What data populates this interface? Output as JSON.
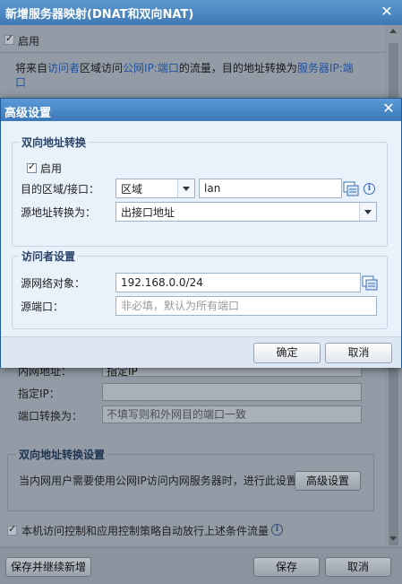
{
  "bg": {
    "title": "新增服务器映射(DNAT和双向NAT)",
    "enable_label": "启用",
    "desc_prefix": "将来自",
    "desc_visitor": "访问者",
    "desc_mid1": "区域访问",
    "desc_publicip": "公网IP",
    "desc_colon": ":",
    "desc_port": "端口",
    "desc_mid2": "的流量，目的地址转换为",
    "desc_serverip": "服务器IP",
    "desc_port2": "端",
    "desc_line2": "口",
    "intranet_label": "内网地址：",
    "intranet_value": "指定IP",
    "specify_ip_label": "指定IP：",
    "port_convert_label": "端口转换为：",
    "port_convert_placeholder": "不填写则和外网目的端口一致",
    "bidir_group_legend": "双向地址转换设置",
    "bidir_desc": "当内网用户需要使用公网IP访问内网服务器时，进行此设置",
    "advanced_button": "高级设置",
    "auto_allow_label": "本机访问控制和应用控制策略自动放行上述条件流量",
    "save_continue_button": "保存并继续新增",
    "save_button": "保存",
    "cancel_button": "取消"
  },
  "adv": {
    "title": "高级设置",
    "nat_group_legend": "双向地址转换",
    "enable_label": "启用",
    "dest_label": "目的区域/接口：",
    "dest_type_value": "区域",
    "dest_value": "lan",
    "src_convert_label": "源地址转换为：",
    "src_convert_value": "出接口地址",
    "visitor_group_legend": "访问者设置",
    "src_net_label": "源网络对象：",
    "src_net_value": "192.168.0.0/24",
    "src_port_label": "源端口：",
    "src_port_placeholder": "非必填，默认为所有端口",
    "ok_button": "确定",
    "cancel_button": "取消"
  }
}
